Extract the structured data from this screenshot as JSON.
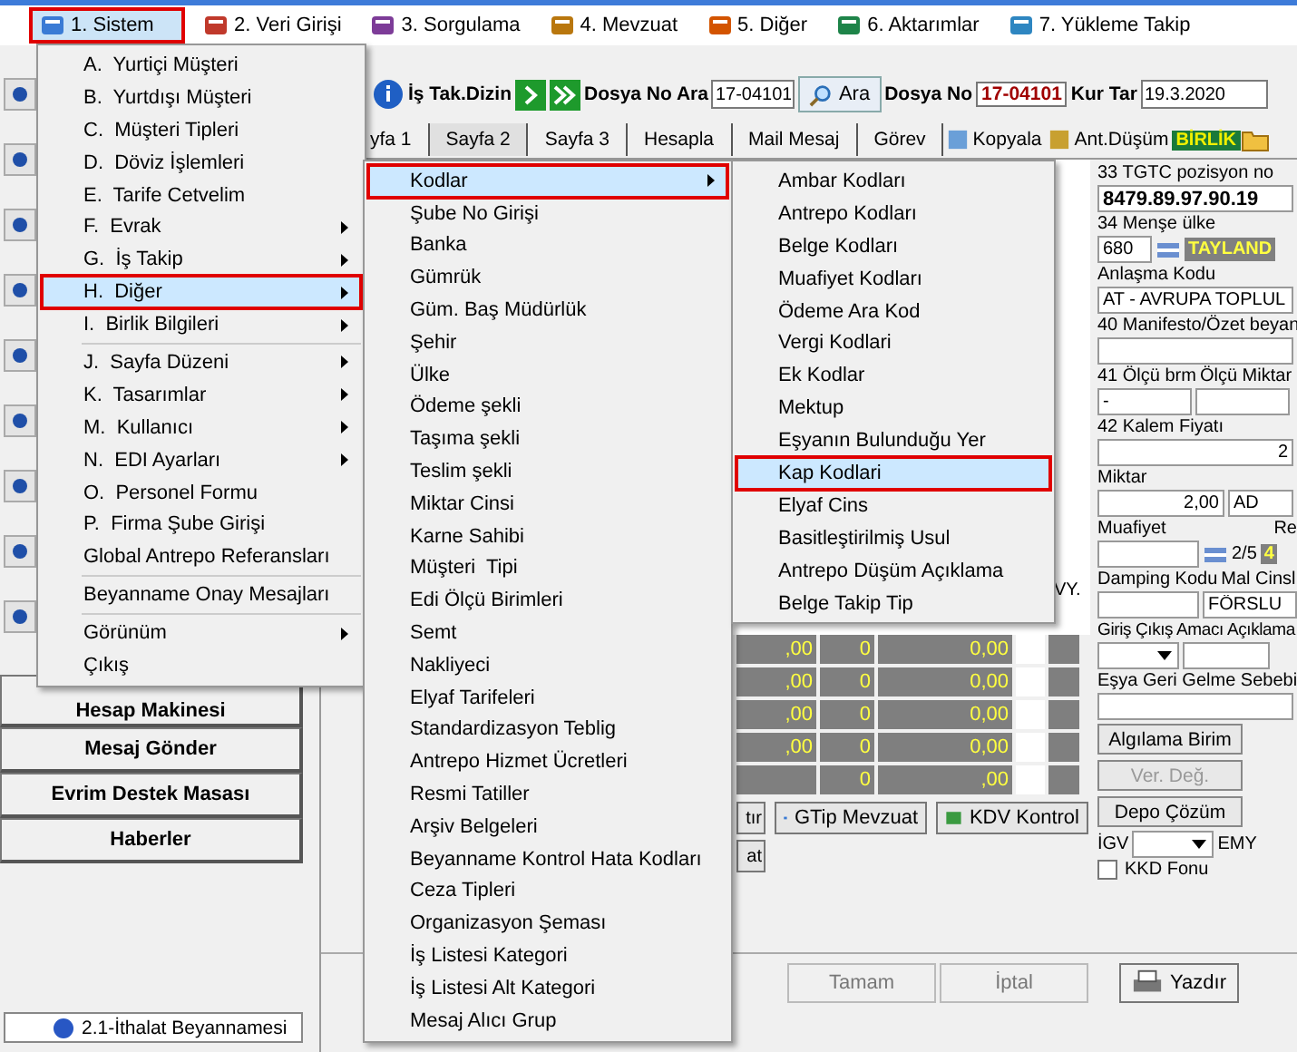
{
  "menu_bar": [
    {
      "label": "1. Sistem",
      "selected": true
    },
    {
      "label": "2. Veri Girişi",
      "selected": false
    },
    {
      "label": "3. Sorgulama",
      "selected": false
    },
    {
      "label": "4. Mevzuat",
      "selected": false
    },
    {
      "label": "5. Diğer",
      "selected": false
    },
    {
      "label": "6. Aktarımlar",
      "selected": false
    },
    {
      "label": "7. Yükleme Takip",
      "selected": false
    }
  ],
  "toolbar": {
    "index_label": "İş Tak.Dizin",
    "search_label": "Dosya No Ara",
    "search_value": "17-04101",
    "search_button": "Ara",
    "file_label": "Dosya No",
    "file_value": "17-04101",
    "rate_date_label": "Kur Tar",
    "rate_date_value": "19.3.2020"
  },
  "tabs": [
    {
      "label": "yfa 1",
      "selected": false
    },
    {
      "label": "Sayfa 2",
      "selected": true
    },
    {
      "label": "Sayfa 3",
      "selected": false
    },
    {
      "label": "Hesapla",
      "selected": false
    },
    {
      "label": "Mail Mesaj",
      "selected": false
    },
    {
      "label": "Görev",
      "selected": false
    }
  ],
  "tool_buttons": [
    {
      "label": "Kopyala"
    },
    {
      "label": "Ant.Düşüm"
    }
  ],
  "union_badge": "BİRLİK",
  "sidebar_buttons": [
    "Hesap Makinesi",
    "Mesaj Gönder",
    "Evrim Destek Masası",
    "Haberler"
  ],
  "taskbar_tab": "2.1-İthalat Beyannamesi",
  "grid": {
    "header": "VY.",
    "rows": [
      {
        "amount": ",00",
        "count": "0",
        "total": "0,00"
      },
      {
        "amount": ",00",
        "count": "0",
        "total": "0,00"
      },
      {
        "amount": ",00",
        "count": "0",
        "total": "0,00"
      },
      {
        "amount": ",00",
        "count": "0",
        "total": "0,00"
      },
      {
        "amount": "",
        "count": "0",
        "total": ",00"
      }
    ]
  },
  "grid_buttons": [
    "tır",
    "GTip Mevzuat",
    "KDV Kontrol",
    "at"
  ],
  "right_panel": {
    "tgtc_label": "33 TGTC pozisyon no",
    "tgtc_value": "8479.89.97.90.19",
    "origin_label": "34 Menşe ülke",
    "origin_code": "680",
    "origin_name": "TAYLAND",
    "agreement_label": "Anlaşma Kodu",
    "agreement_value": "AT - AVRUPA TOPLUL",
    "manifest_label": "40 Manifesto/Özet beyan",
    "unit_label": "41 Ölçü brm",
    "unit_value": "-",
    "unit_qty_label": "Ölçü Miktar",
    "price_label": "42 Kalem Fiyatı",
    "price_value": "2",
    "qty_label": "Miktar",
    "qty_value": "2,00",
    "qty_unit": "AD",
    "exemption_label": "Muafiyet",
    "exemption_page": "2/5",
    "re_label": "Re",
    "re_value": "4",
    "dumping_label": "Damping Kodu",
    "goods_label": "Mal Cinsl",
    "goods_value": "FÖRSLU",
    "purpose_label": "Giriş Çıkış Amacı",
    "desc_label": "Açıklama",
    "return_label": "Eşya Geri Gelme Sebebi",
    "actions": [
      {
        "label": "Algılama Birim",
        "disabled": false
      },
      {
        "label": "Ver. Değ.",
        "disabled": true
      },
      {
        "label": "Depo Çözüm",
        "disabled": false
      }
    ],
    "igv_label": "İGV",
    "emy_label": "EMY",
    "kkd": {
      "label": "KKD Fonu",
      "checked": false
    }
  },
  "bottom_buttons": [
    {
      "label": "Tamam",
      "disabled": true
    },
    {
      "label": "İptal",
      "disabled": true
    },
    {
      "label": "Yazdır",
      "disabled": false
    }
  ],
  "sistem_menu": {
    "groups": [
      [
        {
          "label": "A.  Yurtiçi Müşteri",
          "has_submenu": false,
          "selected": false
        },
        {
          "label": "B.  Yurtdışı Müşteri",
          "has_submenu": false,
          "selected": false
        },
        {
          "label": "C.  Müşteri Tipleri",
          "has_submenu": false,
          "selected": false
        },
        {
          "label": "D.  Döviz İşlemleri",
          "has_submenu": false,
          "selected": false
        },
        {
          "label": "E.  Tarife Cetvelim",
          "has_submenu": false,
          "selected": false
        },
        {
          "label": "F.  Evrak",
          "has_submenu": true,
          "selected": false
        },
        {
          "label": "G.  İş Takip",
          "has_submenu": true,
          "selected": false
        },
        {
          "label": "H.  Diğer",
          "has_submenu": true,
          "selected": true
        },
        {
          "label": "I.  Birlik Bilgileri",
          "has_submenu": true,
          "selected": false
        }
      ],
      [
        {
          "label": "J.  Sayfa Düzeni",
          "has_submenu": true,
          "selected": false
        },
        {
          "label": "K.  Tasarımlar",
          "has_submenu": true,
          "selected": false
        },
        {
          "label": "M.  Kullanıcı",
          "has_submenu": true,
          "selected": false
        },
        {
          "label": "N.  EDI Ayarları",
          "has_submenu": true,
          "selected": false
        },
        {
          "label": "O.  Personel Formu",
          "has_submenu": false,
          "selected": false
        },
        {
          "label": "P.  Firma Şube Girişi",
          "has_submenu": false,
          "selected": false
        },
        {
          "label": "Global Antrepo Referansları",
          "has_submenu": false,
          "selected": false
        }
      ],
      [
        {
          "label": "Beyanname Onay Mesajları",
          "has_submenu": false,
          "selected": false
        }
      ],
      [
        {
          "label": "Görünüm",
          "has_submenu": true,
          "selected": false
        },
        {
          "label": "Çıkış",
          "has_submenu": false,
          "selected": false
        }
      ]
    ]
  },
  "diger_menu": {
    "items": [
      {
        "label": "Kodlar",
        "has_submenu": true,
        "selected": true
      },
      {
        "label": "Şube No Girişi",
        "has_submenu": false,
        "selected": false
      },
      {
        "label": "Banka",
        "has_submenu": false,
        "selected": false
      },
      {
        "label": "Gümrük",
        "has_submenu": false,
        "selected": false
      },
      {
        "label": "Güm. Baş Müdürlük",
        "has_submenu": false,
        "selected": false
      },
      {
        "label": "Şehir",
        "has_submenu": false,
        "selected": false
      },
      {
        "label": "Ülke",
        "has_submenu": false,
        "selected": false
      },
      {
        "label": "Ödeme şekli",
        "has_submenu": false,
        "selected": false
      },
      {
        "label": "Taşıma şekli",
        "has_submenu": false,
        "selected": false
      },
      {
        "label": "Teslim şekli",
        "has_submenu": false,
        "selected": false
      },
      {
        "label": "Miktar Cinsi",
        "has_submenu": false,
        "selected": false
      },
      {
        "label": "Karne Sahibi",
        "has_submenu": false,
        "selected": false
      },
      {
        "label": "Müşteri  Tipi",
        "has_submenu": false,
        "selected": false
      },
      {
        "label": "Edi Ölçü Birimleri",
        "has_submenu": false,
        "selected": false
      },
      {
        "label": "Semt",
        "has_submenu": false,
        "selected": false
      },
      {
        "label": "Nakliyeci",
        "has_submenu": false,
        "selected": false
      },
      {
        "label": "Elyaf Tarifeleri",
        "has_submenu": false,
        "selected": false
      },
      {
        "label": "Standardizasyon Teblig",
        "has_submenu": false,
        "selected": false
      },
      {
        "label": "Antrepo Hizmet Ücretleri",
        "has_submenu": false,
        "selected": false
      },
      {
        "label": "Resmi Tatiller",
        "has_submenu": false,
        "selected": false
      },
      {
        "label": "Arşiv Belgeleri",
        "has_submenu": false,
        "selected": false
      },
      {
        "label": "Beyanname Kontrol Hata Kodları",
        "has_submenu": false,
        "selected": false
      },
      {
        "label": "Ceza Tipleri",
        "has_submenu": false,
        "selected": false
      },
      {
        "label": "Organizasyon Şeması",
        "has_submenu": false,
        "selected": false
      },
      {
        "label": "İş Listesi Kategori",
        "has_submenu": false,
        "selected": false
      },
      {
        "label": "İş Listesi Alt Kategori",
        "has_submenu": false,
        "selected": false
      },
      {
        "label": "Mesaj Alıcı Grup",
        "has_submenu": false,
        "selected": false
      }
    ]
  },
  "kodlar_menu": {
    "items": [
      {
        "label": "Ambar Kodları",
        "selected": false
      },
      {
        "label": "Antrepo Kodları",
        "selected": false
      },
      {
        "label": "Belge Kodları",
        "selected": false
      },
      {
        "label": "Muafiyet Kodları",
        "selected": false
      },
      {
        "label": "Ödeme Ara Kod",
        "selected": false
      },
      {
        "label": "Vergi Kodlari",
        "selected": false
      },
      {
        "label": "Ek Kodlar",
        "selected": false
      },
      {
        "label": "Mektup",
        "selected": false
      },
      {
        "label": "Eşyanın Bulunduğu Yer",
        "selected": false
      },
      {
        "label": "Kap Kodlari",
        "selected": true
      },
      {
        "label": "Elyaf Cins",
        "selected": false
      },
      {
        "label": "Basitleştirilmiş Usul",
        "selected": false
      },
      {
        "label": "Antrepo Düşüm Açıklama",
        "selected": false
      },
      {
        "label": "Belge Takip Tip",
        "selected": false
      }
    ]
  }
}
